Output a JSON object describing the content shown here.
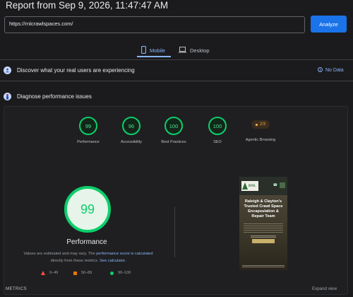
{
  "header": {
    "report_title": "Report from Sep 9, 2026, 11:47:47 AM"
  },
  "url_bar": {
    "value": "https://rnlcrawlspaces.com/",
    "analyze_label": "Analyze"
  },
  "device_tabs": [
    {
      "label": "Mobile",
      "icon": "smartphone-icon",
      "selected": true
    },
    {
      "label": "Desktop",
      "icon": "laptop-icon",
      "selected": false
    }
  ],
  "real_users": {
    "title": "Discover what your real users are experiencing",
    "status": "No Data"
  },
  "diagnose": {
    "title": "Diagnose performance issues"
  },
  "category_scores": [
    {
      "label": "Performance",
      "score": "99"
    },
    {
      "label": "Accessibility",
      "score": "96"
    },
    {
      "label": "Best Practices",
      "score": "100"
    },
    {
      "label": "SEO",
      "score": "100"
    },
    {
      "label": "Agentic Browsing",
      "score": "2/3"
    }
  ],
  "performance": {
    "score": "99",
    "label": "Performance",
    "note_before": "Values are estimated and may vary. The ",
    "note_link1": "performance score is calculated",
    "note_middle": " directly from these metrics. ",
    "note_link2": "See calculator."
  },
  "legend": [
    {
      "range": "0–49",
      "shape": "triangle",
      "color": "#ff4e42"
    },
    {
      "range": "50–89",
      "shape": "square",
      "color": "#e67700"
    },
    {
      "range": "90–100",
      "shape": "circle",
      "color": "#0cce6b"
    }
  ],
  "screenshot": {
    "logo_text": "RNL",
    "hero_heading": "Raleigh & Clayton's Trusted Crawl Space Encapsulation & Repair Team"
  },
  "metrics": {
    "label": "METRICS",
    "expand_label": "Expand view"
  },
  "colors": {
    "accent": "#1a73e8",
    "pass": "#0cce6b",
    "average": "#e67700",
    "fail": "#ff4e42"
  }
}
